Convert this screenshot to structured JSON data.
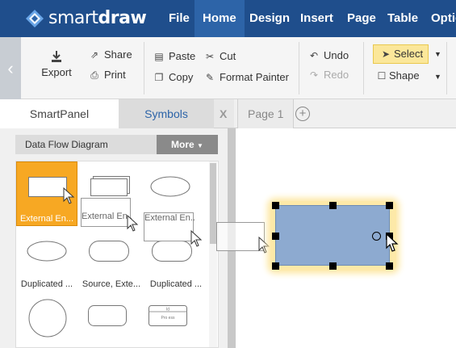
{
  "app": {
    "brand_light": "smart",
    "brand_bold": "draw",
    "logo_icon": "smartdraw-diamond-logo",
    "brand_color": "#1f4e8c"
  },
  "menu": [
    {
      "label": "File"
    },
    {
      "label": "Home",
      "active": true
    },
    {
      "label": "Design"
    },
    {
      "label": "Insert"
    },
    {
      "label": "Page"
    },
    {
      "label": "Table"
    },
    {
      "label": "Optio"
    }
  ],
  "ribbon": {
    "export": "Export",
    "share": "Share",
    "print": "Print",
    "paste": "Paste",
    "copy": "Copy",
    "cut": "Cut",
    "format_painter": "Format Painter",
    "undo": "Undo",
    "redo": "Redo",
    "select": "Select",
    "shape": "Shape",
    "select_color": "#fbe79a"
  },
  "panel": {
    "tab_smart": "SmartPanel",
    "tab_symbols": "Symbols",
    "close": "X",
    "library": "Data Flow Diagram",
    "more": "More",
    "selected_color": "#f7a823",
    "symbols": [
      {
        "label": "External En...",
        "shape": "rect",
        "selected": true
      },
      {
        "label": "",
        "shape": "rect-3d"
      },
      {
        "label": "",
        "shape": "ellipse"
      },
      {
        "label": "Duplicated ...",
        "shape": "ellipse"
      },
      {
        "label": "Source, Exte...",
        "shape": "rounded-rect"
      },
      {
        "label": "Duplicated ...",
        "shape": "rounded-rect-shadow"
      },
      {
        "label": "",
        "shape": "circle"
      },
      {
        "label": "",
        "shape": "rounded-rect"
      },
      {
        "label": "",
        "shape": "data-store"
      }
    ],
    "drag_ghost_labels": [
      "External En...",
      "External En..."
    ],
    "data_store_text": [
      "Id",
      "Pro ess"
    ]
  },
  "document": {
    "page_tab": "Page 1",
    "add_page": "+",
    "shape_fill": "#8daad0",
    "handle_color": "#000000",
    "glow_color": "#fde9a8"
  }
}
